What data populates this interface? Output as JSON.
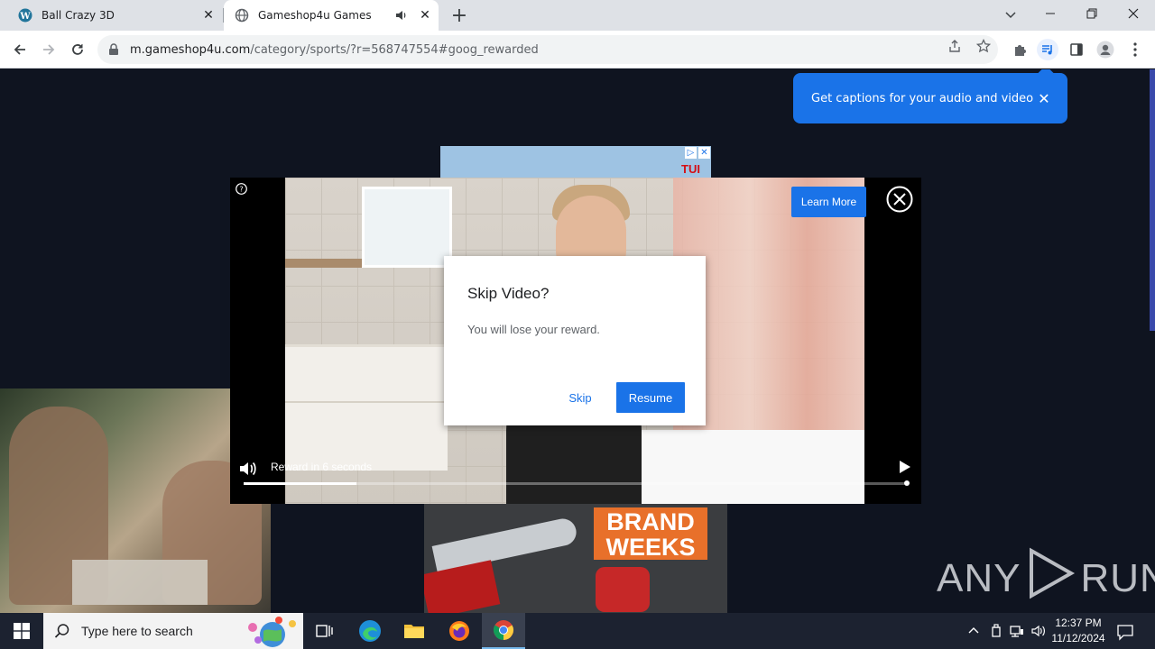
{
  "browser": {
    "tabs": [
      {
        "title": "Ball Crazy 3D",
        "favicon": "wordpress-icon"
      },
      {
        "title": "Gameshop4u Games",
        "favicon": "globe-icon",
        "audio": true
      }
    ],
    "url_host": "m.gameshop4u.com",
    "url_path": "/category/sports/?r=568747554#goog_rewarded"
  },
  "captions_bubble": {
    "text": "Get captions for your audio and video"
  },
  "video_ad": {
    "learn_more_label": "Learn More",
    "reward_text": "Reward in 6 seconds",
    "progress_fraction": 0.17
  },
  "dialog": {
    "title": "Skip Video?",
    "message": "You will lose your reward.",
    "skip_label": "Skip",
    "resume_label": "Resume"
  },
  "background_ads": {
    "top_brand": "TUI",
    "bottom_lines": [
      "BRAND",
      "WEEKS"
    ]
  },
  "watermark": {
    "left": "ANY",
    "right": "RUN"
  },
  "taskbar": {
    "search_placeholder": "Type here to search",
    "time": "12:37 PM",
    "date": "11/12/2024"
  },
  "colors": {
    "accent": "#1a73e8",
    "page_bg": "#0f1420",
    "taskbar": "#1c2230"
  }
}
